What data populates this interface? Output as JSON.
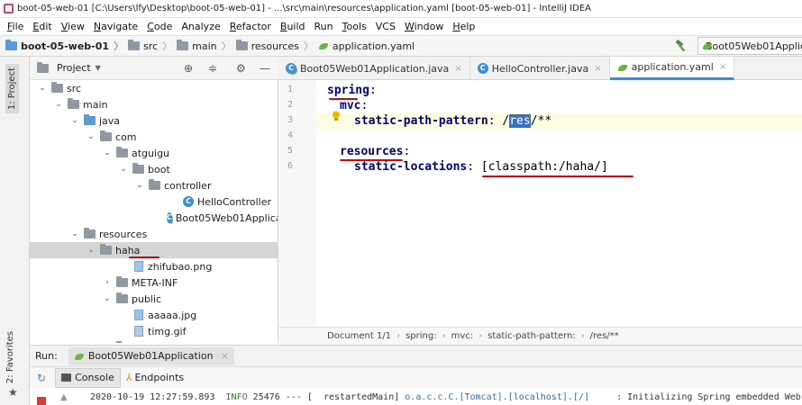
{
  "window": {
    "title": "boot-05-web-01 [C:\\Users\\lfy\\Desktop\\boot-05-web-01] - ...\\src\\main\\resources\\application.yaml [boot-05-web-01] - IntelliJ IDEA"
  },
  "menu": [
    {
      "mn": "F",
      "rest": "ile"
    },
    {
      "mn": "E",
      "rest": "dit"
    },
    {
      "mn": "V",
      "rest": "iew"
    },
    {
      "mn": "N",
      "rest": "avigate"
    },
    {
      "mn": "C",
      "rest": "ode"
    },
    {
      "mn": "",
      "rest": "Analyze"
    },
    {
      "mn": "R",
      "rest": "efactor"
    },
    {
      "mn": "B",
      "rest": "uild"
    },
    {
      "mn": "",
      "rest": "Run"
    },
    {
      "mn": "T",
      "rest": "ools"
    },
    {
      "mn": "",
      "rest": "VCS"
    },
    {
      "mn": "W",
      "rest": "indow"
    },
    {
      "mn": "H",
      "rest": "elp"
    }
  ],
  "navbar": {
    "crumbs": [
      "boot-05-web-01",
      "src",
      "main",
      "resources",
      "application.yaml"
    ],
    "run_config": "Boot05Web01Applic"
  },
  "left_strip": {
    "project_tab": "1: Project",
    "favorites_tab": "2: Favorites"
  },
  "project_panel": {
    "title": "Project",
    "tree": [
      {
        "label": "src"
      },
      {
        "label": "main"
      },
      {
        "label": "java"
      },
      {
        "label": "com"
      },
      {
        "label": "atguigu"
      },
      {
        "label": "boot"
      },
      {
        "label": "controller"
      },
      {
        "label": "HelloController"
      },
      {
        "label": "Boot05Web01Applicati"
      },
      {
        "label": "resources"
      },
      {
        "label": "haha"
      },
      {
        "label": "zhifubao.png"
      },
      {
        "label": "META-INF"
      },
      {
        "label": "public"
      },
      {
        "label": "aaaaa.jpg"
      },
      {
        "label": "timg.gif"
      },
      {
        "label": "resources"
      }
    ]
  },
  "editor": {
    "tabs": [
      {
        "label": "Boot05Web01Application.java",
        "active": false
      },
      {
        "label": "HelloController.java",
        "active": false
      },
      {
        "label": "application.yaml",
        "active": true
      }
    ],
    "line_numbers": [
      "1",
      "2",
      "3",
      "4",
      "5",
      "6"
    ],
    "code": {
      "l1_key": "spring",
      "l1_colon": ":",
      "l2_key": "mvc",
      "l2_colon": ":",
      "l3_key": "static-path-pattern",
      "l3_sep": ": /",
      "l3_hl": "res",
      "l3_rest": "/**",
      "l5_key": "resources",
      "l5_colon": ":",
      "l6_key": "static-locations",
      "l6_sep": ": ",
      "l6_val": "[classpath:/haha/]"
    },
    "breadcrumbs": [
      "Document 1/1",
      "spring:",
      "mvc:",
      "static-path-pattern:",
      "/res/**"
    ]
  },
  "run_panel": {
    "label": "Run:",
    "tab": "Boot05Web01Application",
    "console_tab": "Console",
    "endpoints_tab": "Endpoints",
    "log": {
      "time": "2020-10-19 12:27:59.893",
      "level": "INFO",
      "pid": "25476",
      "sep": "---",
      "thread": "[  restartedMain]",
      "logger": "o.a.c.c.C.[Tomcat].[localhost].[/]",
      "message": ": Initializing Spring embedded Web"
    }
  },
  "colors": {
    "annotation": "#e00000",
    "selection": "#3d6fbf",
    "yaml_key": "#000080"
  }
}
